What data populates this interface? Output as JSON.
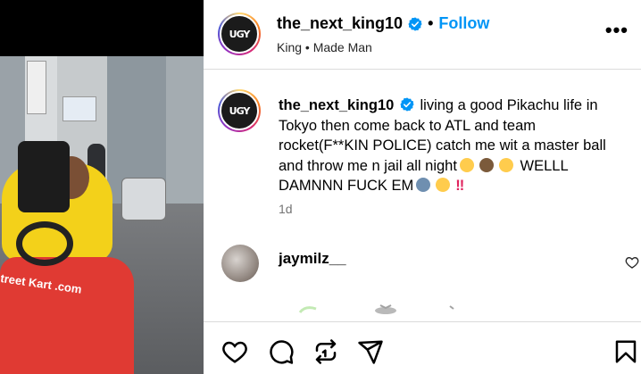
{
  "post": {
    "username": "the_next_king10",
    "verified": true,
    "separator": "•",
    "follow_label": "Follow",
    "subtitle": "King • Made Man",
    "more_label": "•••",
    "avatar_logo_text": "UGY"
  },
  "caption": {
    "username": "the_next_king10",
    "text_part1": "living a good Pikachu life in Tokyo then come back to ATL and team rocket(F**KIN POLICE) catch me wit a master ball and throw me n jail all night",
    "text_part2": "WELLL DAMNNN FUCK EM",
    "time": "1d"
  },
  "comments": [
    {
      "username": "jaymilz__"
    }
  ],
  "media": {
    "kart_text": "treet Kart .com"
  },
  "icons": [
    "heart-icon",
    "comment-icon",
    "repost-icon",
    "share-icon",
    "bookmark-icon",
    "verified-icon",
    "more-icon"
  ],
  "colors": {
    "accent": "#0095f6",
    "text": "#000000",
    "muted": "#737373",
    "divider": "#dbdbdb"
  }
}
